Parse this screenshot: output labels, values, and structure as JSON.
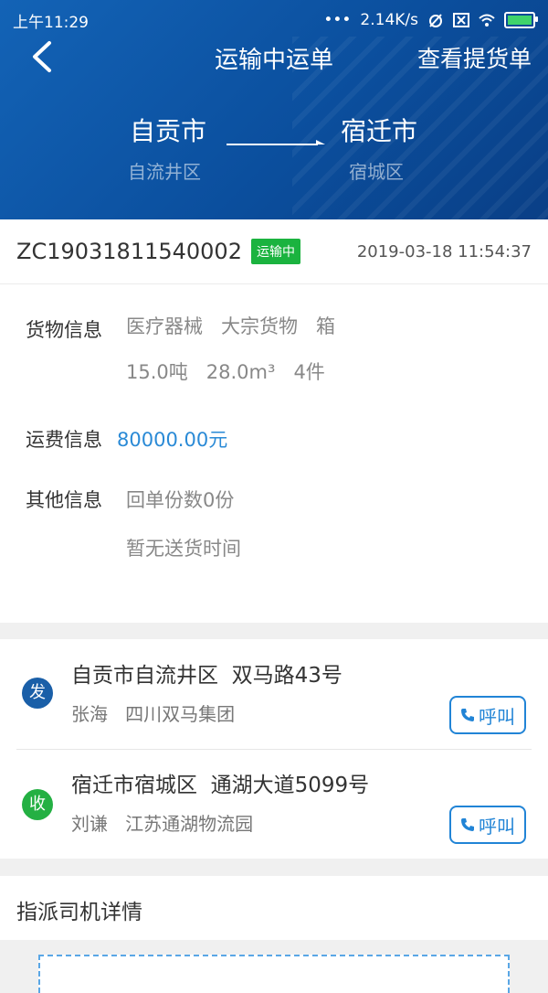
{
  "status_bar": {
    "time": "上午11:29",
    "dots": "•••",
    "speed": "2.14K/s",
    "icons": [
      "alarm-muted-icon",
      "close-box-icon",
      "wifi-icon",
      "battery-icon"
    ]
  },
  "nav": {
    "title": "运输中运单",
    "action": "查看提货单",
    "back_icon": "chevron-left-icon"
  },
  "route": {
    "from_city": "自贡市",
    "from_district": "自流井区",
    "to_city": "宿迁市",
    "to_district": "宿城区"
  },
  "order": {
    "number": "ZC19031811540002",
    "status": "运输中",
    "time": "2019-03-18 11:54:37"
  },
  "cargo": {
    "label": "货物信息",
    "line1": "医疗器械   大宗货物   箱",
    "line2": "15.0吨   28.0m³   4件"
  },
  "freight": {
    "label": "运费信息",
    "value": "80000.00元"
  },
  "other": {
    "label": "其他信息",
    "line1": "回单份数0份",
    "line2": "暂无送货时间"
  },
  "sender": {
    "tag": "发",
    "address": "自贡市自流井区  双马路43号",
    "contact": "张海   四川双马集团",
    "call": "呼叫"
  },
  "receiver": {
    "tag": "收",
    "address": "宿迁市宿城区  通湖大道5099号",
    "contact": "刘谦   江苏通湖物流园",
    "call": "呼叫"
  },
  "driver": {
    "title": "指派司机详情"
  },
  "colors": {
    "header": "#0b4f9e",
    "badge": "#1bb33f",
    "freight": "#2a8ad6",
    "sender_pin": "#1a5fa8",
    "receiver_pin": "#24b043"
  }
}
